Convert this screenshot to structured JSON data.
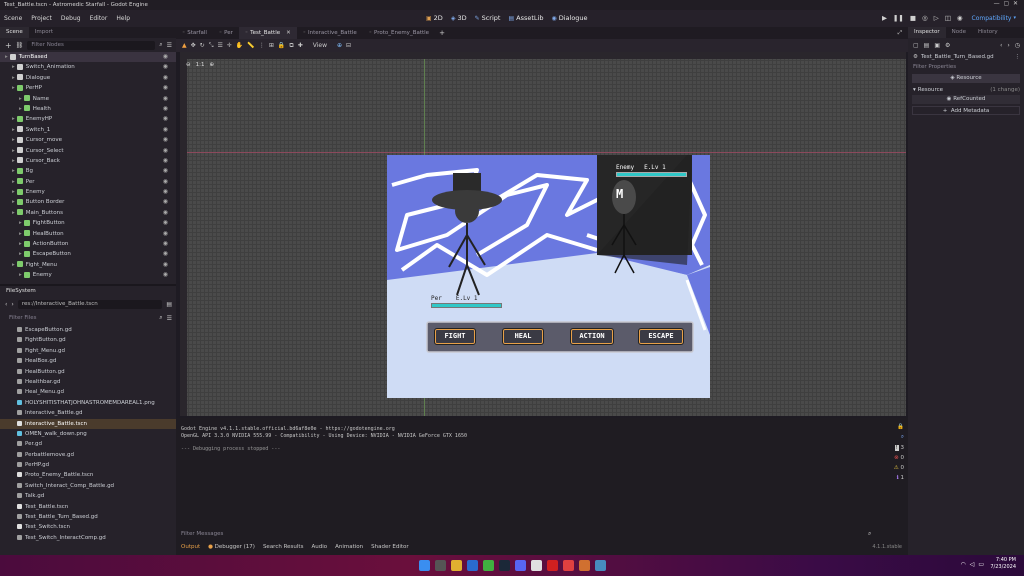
{
  "window": {
    "title": "Test_Battle.tscn - Astromedic Starfall - Godot Engine"
  },
  "menubar": {
    "menus": [
      "Scene",
      "Project",
      "Debug",
      "Editor",
      "Help"
    ],
    "workspaces": [
      {
        "glyph": "▣",
        "label": "2D"
      },
      {
        "glyph": "◈",
        "label": "3D"
      },
      {
        "glyph": "✎",
        "label": "Script"
      },
      {
        "glyph": "▤",
        "label": "AssetLib"
      },
      {
        "glyph": "◉",
        "label": "Dialogue"
      }
    ],
    "renderer": "Compatibility"
  },
  "scene_dock": {
    "tabs": [
      "Scene",
      "Import"
    ],
    "filter_placeholder": "Filter Nodes",
    "nodes": [
      {
        "name": "TurnBased",
        "indent": 0,
        "color": "w",
        "selected": true
      },
      {
        "name": "Switch_Animation",
        "indent": 1,
        "color": "w"
      },
      {
        "name": "Dialogue",
        "indent": 1,
        "color": "w"
      },
      {
        "name": "PerHP",
        "indent": 1,
        "color": "g"
      },
      {
        "name": "Name",
        "indent": 2,
        "color": "g"
      },
      {
        "name": "Health",
        "indent": 2,
        "color": "g"
      },
      {
        "name": "EnemyHP",
        "indent": 1,
        "color": "g"
      },
      {
        "name": "Switch_1",
        "indent": 1,
        "color": "w"
      },
      {
        "name": "Cursor_move",
        "indent": 1,
        "color": "w"
      },
      {
        "name": "Cursor_Select",
        "indent": 1,
        "color": "w"
      },
      {
        "name": "Cursor_Back",
        "indent": 1,
        "color": "w"
      },
      {
        "name": "Bg",
        "indent": 1,
        "color": "g"
      },
      {
        "name": "Per",
        "indent": 1,
        "color": "g"
      },
      {
        "name": "Enemy",
        "indent": 1,
        "color": "g"
      },
      {
        "name": "Button Border",
        "indent": 1,
        "color": "g"
      },
      {
        "name": "Main_Buttons",
        "indent": 1,
        "color": "g"
      },
      {
        "name": "FightButton",
        "indent": 2,
        "color": "g"
      },
      {
        "name": "HealButton",
        "indent": 2,
        "color": "g"
      },
      {
        "name": "ActionButton",
        "indent": 2,
        "color": "g"
      },
      {
        "name": "EscapeButton",
        "indent": 2,
        "color": "g"
      },
      {
        "name": "Fight_Menu",
        "indent": 1,
        "color": "g"
      },
      {
        "name": "Enemy",
        "indent": 2,
        "color": "g"
      }
    ]
  },
  "filesystem": {
    "title": "FileSystem",
    "path": "res://Interactive_Battle.tscn",
    "filter_placeholder": "Filter Files",
    "files": [
      {
        "name": "EscapeButton.gd",
        "kind": "gd"
      },
      {
        "name": "FightButton.gd",
        "kind": "gd"
      },
      {
        "name": "Fight_Menu.gd",
        "kind": "gd"
      },
      {
        "name": "HealBox.gd",
        "kind": "gd"
      },
      {
        "name": "HealButton.gd",
        "kind": "gd"
      },
      {
        "name": "Healthbar.gd",
        "kind": "gd"
      },
      {
        "name": "Heal_Menu.gd",
        "kind": "gd"
      },
      {
        "name": "HOLYSHITISTHATJOHNASTROMEMDAREAL1.png",
        "kind": "png"
      },
      {
        "name": "Interactive_Battle.gd",
        "kind": "gd"
      },
      {
        "name": "Interactive_Battle.tscn",
        "kind": "tscn",
        "selected": true
      },
      {
        "name": "OMEN_walk_down.png",
        "kind": "png"
      },
      {
        "name": "Per.gd",
        "kind": "gd"
      },
      {
        "name": "Perbattlemove.gd",
        "kind": "gd"
      },
      {
        "name": "PerHP.gd",
        "kind": "gd"
      },
      {
        "name": "Proto_Enemy_Battle.tscn",
        "kind": "tscn"
      },
      {
        "name": "Switch_Interact_Comp_Battle.gd",
        "kind": "gd"
      },
      {
        "name": "Talk.gd",
        "kind": "gd"
      },
      {
        "name": "Test_Battle.tscn",
        "kind": "tscn"
      },
      {
        "name": "Test_Battle_Turn_Based.gd",
        "kind": "gd"
      },
      {
        "name": "Test_Switch.tscn",
        "kind": "tscn"
      },
      {
        "name": "Test_Switch_InteractComp.gd",
        "kind": "gd"
      }
    ]
  },
  "editor_tabs": [
    {
      "label": "Starfall",
      "active": false
    },
    {
      "label": "Per",
      "active": false
    },
    {
      "label": "Test_Battle",
      "active": true
    },
    {
      "label": "Interactive_Battle",
      "active": false
    },
    {
      "label": "Proto_Enemy_Battle",
      "active": false
    }
  ],
  "viewport": {
    "view_label": "View",
    "zoom": "1:1"
  },
  "game": {
    "player_label": "Per",
    "player_level": "E.Lv 1",
    "enemy_label": "Enemy",
    "enemy_level": "E.Lv 1",
    "enemy_glyph": "M",
    "buttons": [
      "FIGHT",
      "HEAL",
      "ACTION",
      "ESCAPE"
    ],
    "bg_color": "#6a78e0",
    "accent": "#e8a048",
    "hp_color": "#30c8c8"
  },
  "output": {
    "lines": [
      "Godot Engine v4.1.1.stable.official.bd6af8e0e - https://godotengine.org",
      "OpenGL API 3.3.0 NVIDIA 555.99 - Compatibility - Using Device: NVIDIA - NVIDIA GeForce GTX 1650",
      "",
      "--- Debugging process stopped ---"
    ],
    "filter_placeholder": "Filter Messages",
    "counts": [
      "3",
      "0",
      "0",
      "1"
    ]
  },
  "bottom_tabs": [
    "Output",
    "Debugger (17)",
    "Search Results",
    "Audio",
    "Animation",
    "Shader Editor"
  ],
  "version": "4.1.1.stable",
  "inspector": {
    "tabs": [
      "Inspector",
      "Node",
      "History"
    ],
    "resource_file": "Test_Battle_Turn_Based.gd",
    "filter_placeholder": "Filter Properties",
    "section": "Resource",
    "resource_row": "Resource",
    "resource_change": "(1 change)",
    "refcounted": "RefCounted",
    "add_metadata": "Add Metadata"
  },
  "taskbar": {
    "time": "7:40 PM",
    "date": "7/23/2024"
  }
}
